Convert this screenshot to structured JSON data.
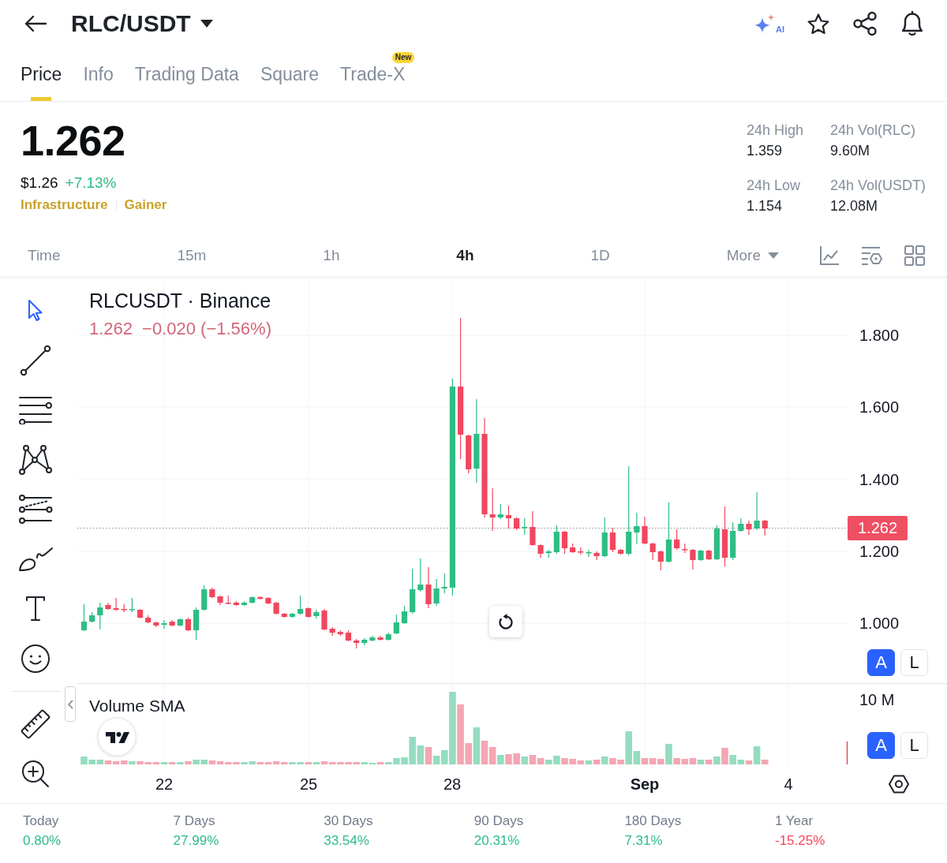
{
  "header": {
    "title": "RLC/USDT",
    "ai_label": "AI"
  },
  "tabs": [
    {
      "label": "Price",
      "selected": true
    },
    {
      "label": "Info",
      "selected": false
    },
    {
      "label": "Trading Data",
      "selected": false
    },
    {
      "label": "Square",
      "selected": false
    },
    {
      "label": "Trade-X",
      "selected": false,
      "badge": "New"
    }
  ],
  "summary": {
    "price": "1.262",
    "fiat_price": "$1.26",
    "change": "+7.13%",
    "rising": true,
    "tags": [
      "Infrastructure",
      "Gainer"
    ],
    "stats": [
      {
        "label": "24h High",
        "value": "1.359"
      },
      {
        "label": "24h Vol(RLC)",
        "value": "9.60M"
      },
      {
        "label": "24h Low",
        "value": "1.154"
      },
      {
        "label": "24h Vol(USDT)",
        "value": "12.08M"
      }
    ]
  },
  "intervals": [
    {
      "label": "Time",
      "kind": "option",
      "selected": false
    },
    {
      "label": "15m",
      "kind": "option",
      "selected": false
    },
    {
      "label": "1h",
      "kind": "option",
      "selected": false
    },
    {
      "label": "4h",
      "kind": "option",
      "selected": true
    },
    {
      "label": "1D",
      "kind": "option",
      "selected": false
    },
    {
      "label": "More",
      "kind": "dropdown",
      "selected": false
    }
  ],
  "tool_groups": [
    {
      "tools": [
        {
          "kind": "cursor",
          "selected": true
        },
        {
          "kind": "line",
          "selected": false
        },
        {
          "kind": "lines",
          "selected": false
        },
        {
          "kind": "pattern",
          "selected": false
        },
        {
          "kind": "levels",
          "selected": false
        },
        {
          "kind": "brush",
          "selected": false
        },
        {
          "kind": "text",
          "selected": false
        },
        {
          "kind": "emoji",
          "selected": false
        }
      ]
    },
    {
      "tools": [
        {
          "kind": "ruler",
          "selected": false
        },
        {
          "kind": "zoom",
          "selected": false
        }
      ]
    }
  ],
  "chart": {
    "symbol": "RLCUSDT · Binance",
    "last": "1.262",
    "change": "−0.020 (−1.56%)",
    "rising": false,
    "price_axis": [
      "1.800",
      "1.600",
      "1.400",
      "1.200",
      "1.000"
    ],
    "price_tag": "1.262",
    "scale_modes": [
      {
        "label": "A",
        "selected": true
      },
      {
        "label": "L",
        "selected": false
      }
    ]
  },
  "volume": {
    "title": "Volume SMA",
    "axis_label": "10 M",
    "scale_modes": [
      {
        "label": "A",
        "selected": true
      },
      {
        "label": "L",
        "selected": false
      }
    ]
  },
  "time_axis": [
    {
      "label": "22",
      "major": false
    },
    {
      "label": "25",
      "major": false
    },
    {
      "label": "28",
      "major": false
    },
    {
      "label": "Sep",
      "major": true
    },
    {
      "label": "4",
      "major": false
    }
  ],
  "performance": [
    {
      "label": "Today",
      "value": "0.80%",
      "rising": true
    },
    {
      "label": "7 Days",
      "value": "27.99%",
      "rising": true
    },
    {
      "label": "30 Days",
      "value": "33.54%",
      "rising": true
    },
    {
      "label": "90 Days",
      "value": "20.31%",
      "rising": true
    },
    {
      "label": "180 Days",
      "value": "7.31%",
      "rising": true
    },
    {
      "label": "1 Year",
      "value": "-15.25%",
      "rising": false
    }
  ]
}
